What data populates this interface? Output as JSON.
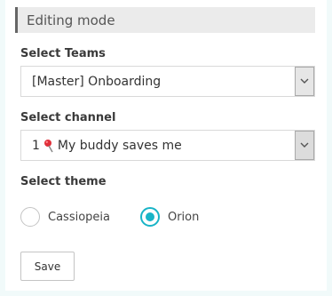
{
  "banner": {
    "text": "Editing mode"
  },
  "teams": {
    "label": "Select Teams",
    "selected": "[Master] Onboarding"
  },
  "channel": {
    "label": "Select channel",
    "selected_prefix": "1",
    "selected_icon": "pushpin-icon",
    "selected_name": "My buddy saves me"
  },
  "theme": {
    "label": "Select theme",
    "options": [
      {
        "label": "Cassiopeia",
        "checked": false
      },
      {
        "label": "Orion",
        "checked": true
      }
    ]
  },
  "actions": {
    "save_label": "Save"
  },
  "colors": {
    "accent": "#19b4c7",
    "page_bg": "#f1fafa",
    "banner_bg": "#ebebeb",
    "banner_bar": "#666666"
  }
}
